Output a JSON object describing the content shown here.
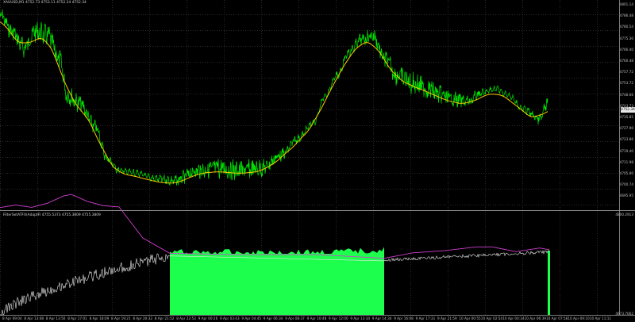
{
  "main": {
    "info_text": "XAUUSD,M1  4752.73 4753.11 4752.24 4752.34",
    "price_labels": [
      "4801.14",
      "4786.48",
      "4780.54",
      "4775.30",
      "4766.40",
      "4760.48",
      "4757.72",
      "4753.72",
      "4748.66",
      "4743.73",
      "4735.85",
      "4727.90",
      "4723.86",
      "4719.40",
      "4711.98",
      "4705.80",
      "4700.74",
      "4695.95"
    ],
    "current_price": "4752.34"
  },
  "indicator": {
    "info_text": "FilterSetATFX(AdaptFI 4755.5373 4755.3809 4755.3809",
    "scale_top": "4800.2913",
    "scale_bottom": "4673.7062"
  },
  "time_labels": [
    "8 Apr 09:04",
    "8 Apr 13:08",
    "8 Apr 13:50",
    "8 Apr 17:01",
    "8 Apr 18:09",
    "8 Apr 19:21",
    "8 Apr 20:32",
    "8 Apr 21:52",
    "8 Apr 22:53",
    "9 Apr 00:26",
    "9 Apr 03:43",
    "9 Apr 04:45",
    "9 Apr 06:34",
    "9 Apr 08:37",
    "9 Apr 10:48",
    "9 Apr 12:00",
    "9 Apr 13:34",
    "9 Apr 14:34",
    "9 Apr 16:08",
    "9 Apr 17:31",
    "9 Apr 21:59",
    "10 Apr 00:55",
    "10 Apr 02:54",
    "10 Apr 04:34",
    "10 Apr 06:39",
    "10 Apr 07:58",
    "10 Apr 09:10",
    "10 Apr 11:11"
  ],
  "colors": {
    "background": "#000000",
    "price_line": "#00e600",
    "moving_average": "#ffc800",
    "magenta_line": "#d040d0",
    "white_line": "#e6e6e6",
    "histogram": "#1cff4c",
    "grid": "#2a2a2a"
  }
}
